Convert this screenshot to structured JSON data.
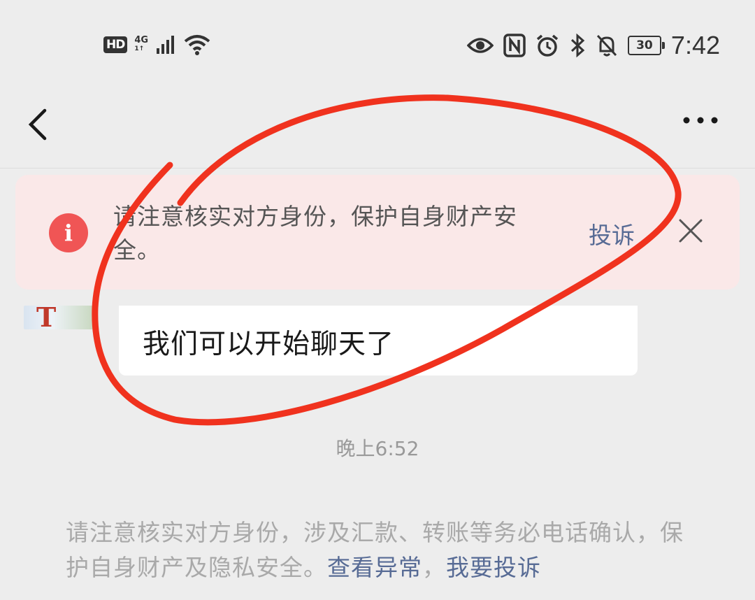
{
  "status_bar": {
    "hd": "HD",
    "network_type": "4G",
    "network_sub": "1↑",
    "battery": "30",
    "time": "7:42",
    "icons": [
      "signal-icon",
      "wifi-icon",
      "eye-icon",
      "nfc-icon",
      "alarm-icon",
      "bluetooth-icon",
      "mute-bell-icon",
      "battery-icon"
    ]
  },
  "nav": {
    "back_icon": "chevron-left-icon",
    "more_icon": "more-dots-icon"
  },
  "warning": {
    "icon": "i",
    "text": "请注意核实对方身份，保护自身财产安全。",
    "complain": "投诉",
    "close_icon": "close-icon"
  },
  "chat": {
    "avatar_letter": "T",
    "message": "我们可以开始聊天了",
    "timestamp": "晚上6:52",
    "notice_text": "请注意核实对方身份，涉及汇款、转账等务必电话确认，保护自身财产及隐私安全。",
    "notice_link_1": "查看异常",
    "notice_sep": "，",
    "notice_link_2": "我要投诉"
  },
  "colors": {
    "background": "#ededed",
    "banner": "#fae8e8",
    "warning_red": "#f05555",
    "link_blue": "#576b95",
    "annotation_red": "#f0321e"
  }
}
